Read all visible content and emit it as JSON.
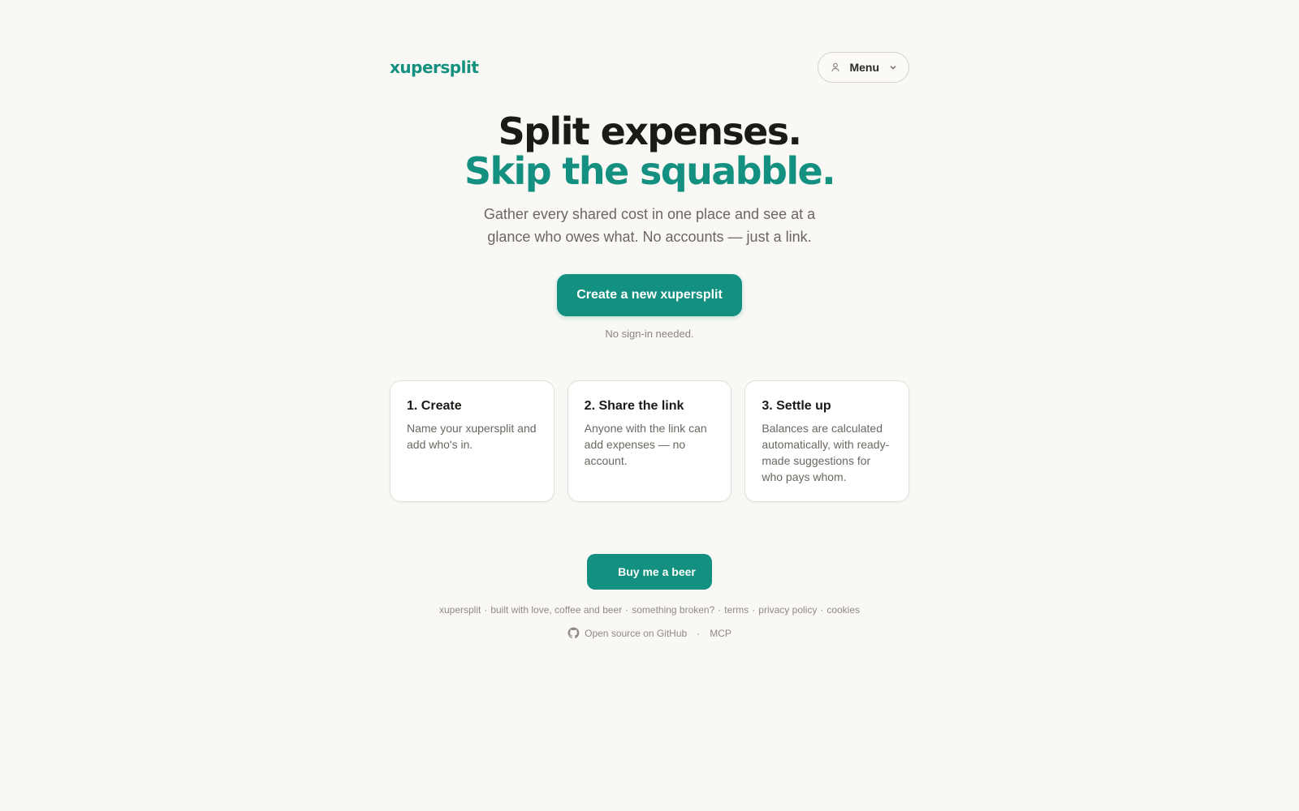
{
  "header": {
    "logo": "xupersplit",
    "menu_label": "Menu",
    "menu_icon": "user-icon",
    "menu_chevron": "chevron-down-icon"
  },
  "hero": {
    "title_line1": "Split expenses.",
    "title_line2": "Skip the squabble.",
    "subtitle": "Gather every shared cost in one place and see at a glance who owes what. No accounts — just a link.",
    "cta_label": "Create a new xupersplit",
    "note": "No sign-in needed."
  },
  "steps": [
    {
      "title": "1. Create",
      "body": "Name your xupersplit and add who's in."
    },
    {
      "title": "2. Share the link",
      "body": "Anyone with the link can add expenses — no account."
    },
    {
      "title": "3. Settle up",
      "body": "Balances are calculated automatically, with ready-made suggestions for who pays whom."
    }
  ],
  "footer": {
    "beer_label": "Buy me a beer",
    "links": {
      "brand": "xupersplit",
      "tagline": "built with love, coffee and beer",
      "broken": "something broken?",
      "terms": "terms",
      "privacy": "privacy policy",
      "cookies": "cookies"
    },
    "separator": "·",
    "github_label": "Open source on GitHub",
    "github_icon": "github-icon",
    "mcp_label": "MCP"
  },
  "colors": {
    "accent": "#13907f",
    "background": "#f9f8f5",
    "text": "#1c1a17",
    "muted": "#6b6760"
  }
}
